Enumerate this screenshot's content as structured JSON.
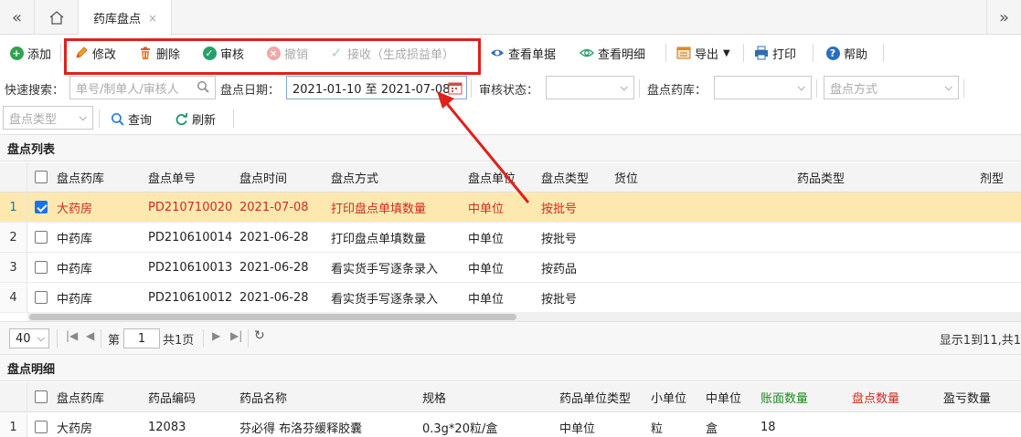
{
  "tabbar": {
    "back_icon": "«",
    "forward_icon": "»",
    "active_tab": "药库盘点",
    "close_glyph": "×"
  },
  "toolbar": {
    "add": "添加",
    "edit": "修改",
    "delete": "删除",
    "audit": "审核",
    "revoke": "撤销",
    "receive": "接收（生成损益单）",
    "view_doc": "查看单据",
    "view_detail": "查看明细",
    "export": "导出",
    "print": "打印",
    "help": "帮助"
  },
  "search": {
    "quick_label": "快速搜索：",
    "quick_placeholder": "单号/制单人/审核人",
    "date_label": "盘点日期：",
    "date_value": "2021-01-10 至 2021-07-08",
    "audit_label": "审核状态：",
    "audit_value": "",
    "pharmacy_label": "盘点药库：",
    "pharmacy_value": "",
    "method_placeholder": "盘点方式",
    "type_placeholder": "盘点类型",
    "query": "查询",
    "refresh": "刷新"
  },
  "list": {
    "title": "盘点列表",
    "columns": [
      "盘点药库",
      "盘点单号",
      "盘点时间",
      "盘点方式",
      "盘点单位",
      "盘点类型",
      "货位",
      "药品类型",
      "剂型"
    ],
    "rows": [
      {
        "num": "1",
        "checked": true,
        "selected": true,
        "pharmacy": "大药房",
        "no": "PD210710020",
        "date": "2021-07-08",
        "method": "打印盘点单填数量",
        "unit": "中单位",
        "type": "按批号"
      },
      {
        "num": "2",
        "checked": false,
        "selected": false,
        "pharmacy": "中药库",
        "no": "PD210610014",
        "date": "2021-06-28",
        "method": "打印盘点单填数量",
        "unit": "中单位",
        "type": "按批号"
      },
      {
        "num": "3",
        "checked": false,
        "selected": false,
        "pharmacy": "中药库",
        "no": "PD210610013",
        "date": "2021-06-28",
        "method": "看实货手写逐条录入",
        "unit": "中单位",
        "type": "按药品"
      },
      {
        "num": "4",
        "checked": false,
        "selected": false,
        "pharmacy": "中药库",
        "no": "PD210610012",
        "date": "2021-06-28",
        "method": "看实货手写逐条录入",
        "unit": "中单位",
        "type": "按批号"
      }
    ]
  },
  "pager": {
    "page_size": "40",
    "page_prefix": "第",
    "page_value": "1",
    "page_suffix": "共1页",
    "summary": "显示1到11,共1"
  },
  "detail": {
    "title": "盘点明细",
    "columns": [
      "盘点药库",
      "药品编码",
      "药品名称",
      "规格",
      "药品单位类型",
      "小单位",
      "中单位",
      "账面数量",
      "盘点数量",
      "盈亏数量"
    ],
    "column_colors": [
      "#222222",
      "#222222",
      "#222222",
      "#222222",
      "#222222",
      "#222222",
      "#222222",
      "#1e8a1e",
      "#d32a1e",
      "#222222"
    ],
    "rows": [
      {
        "num": "1",
        "pharmacy": "大药房",
        "code": "12083",
        "name": "芬必得 布洛芬缓释胶囊",
        "spec": "0.3g*20粒/盒",
        "unit_type": "中单位",
        "small": "粒",
        "mid": "盒",
        "book": "18",
        "count": "",
        "diff": ""
      }
    ]
  },
  "colors": {
    "accent_red": "#e0201a",
    "selected_row": "#fde9b0",
    "selected_text": "#d32a1e"
  }
}
